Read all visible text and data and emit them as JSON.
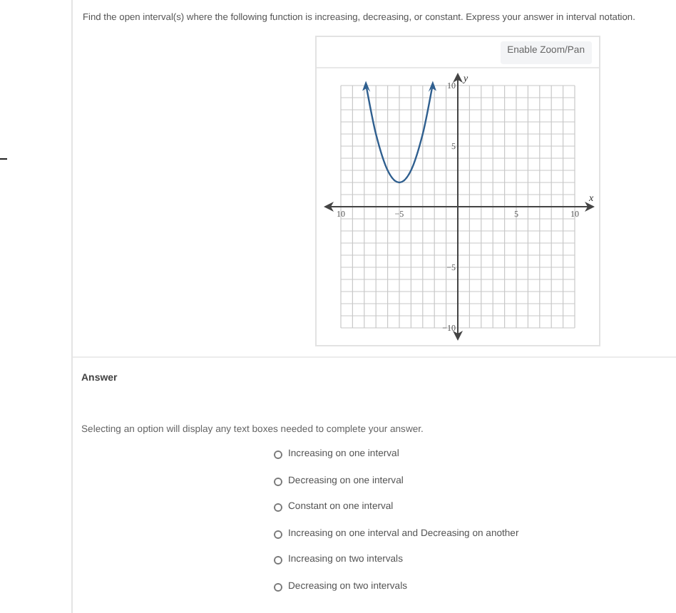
{
  "question": "Find the open interval(s) where the following function is increasing, decreasing, or constant. Express your answer in interval notation.",
  "graph": {
    "button": "Enable Zoom/Pan",
    "chart_data": {
      "type": "line",
      "xlabel": "x",
      "ylabel": "y",
      "xlim": [
        -10,
        10
      ],
      "ylim": [
        -10,
        10
      ],
      "xticks": [
        {
          "value": -10,
          "label": "10"
        },
        {
          "value": -5,
          "label": "−5"
        },
        {
          "value": 5,
          "label": "5"
        },
        {
          "value": 10,
          "label": "10"
        }
      ],
      "yticks": [
        {
          "value": 10,
          "label": "10"
        },
        {
          "value": 5,
          "label": "5"
        },
        {
          "value": -5,
          "label": "−5"
        },
        {
          "value": -10,
          "label": "−10"
        }
      ],
      "x": [
        -7.8,
        -7,
        -6,
        -5,
        -4,
        -3,
        -2.2
      ],
      "grid": true,
      "series": [
        {
          "color": "#2f5f8f",
          "values": [
            9.8,
            6,
            3,
            2,
            3,
            6,
            9.8
          ]
        }
      ]
    }
  },
  "answer_heading": "Answer",
  "instructions": "Selecting an option will display any text boxes needed to complete your answer.",
  "options": [
    {
      "label": "Increasing on one interval",
      "selected": false
    },
    {
      "label": "Decreasing on one interval",
      "selected": false
    },
    {
      "label": "Constant on one interval",
      "selected": false
    },
    {
      "label": "Increasing on one interval and Decreasing on another",
      "selected": false
    },
    {
      "label": "Increasing on two intervals",
      "selected": false
    },
    {
      "label": "Decreasing on two intervals",
      "selected": false
    }
  ]
}
